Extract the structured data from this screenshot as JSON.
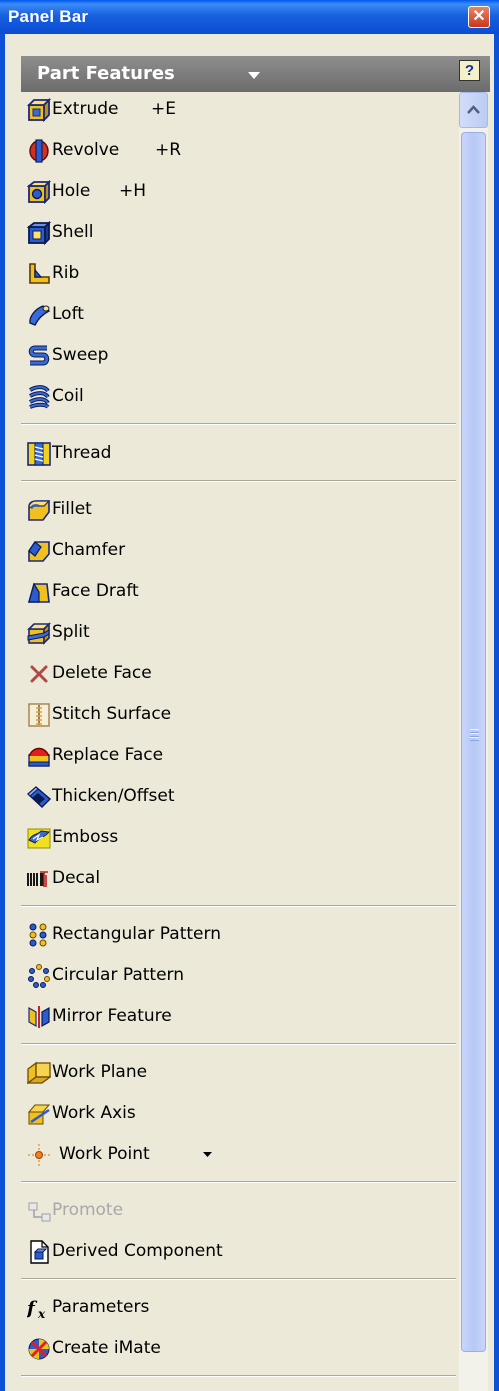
{
  "window": {
    "title": "Panel Bar",
    "close_glyph": "✕"
  },
  "panel": {
    "title": "Part Features",
    "help_glyph": "?"
  },
  "items": [
    {
      "label": "Extrude",
      "shortcut": "+E",
      "icon": "extrude-icon"
    },
    {
      "label": "Revolve",
      "shortcut": "+R",
      "icon": "revolve-icon"
    },
    {
      "label": "Hole",
      "shortcut": "+H",
      "icon": "hole-icon"
    },
    {
      "label": "Shell",
      "icon": "shell-icon"
    },
    {
      "label": "Rib",
      "icon": "rib-icon"
    },
    {
      "label": "Loft",
      "icon": "loft-icon"
    },
    {
      "label": "Sweep",
      "icon": "sweep-icon"
    },
    {
      "label": "Coil",
      "icon": "coil-icon"
    },
    {
      "label": "Thread",
      "icon": "thread-icon"
    },
    {
      "label": "Fillet",
      "icon": "fillet-icon"
    },
    {
      "label": "Chamfer",
      "icon": "chamfer-icon"
    },
    {
      "label": "Face Draft",
      "icon": "face-draft-icon"
    },
    {
      "label": "Split",
      "icon": "split-icon"
    },
    {
      "label": "Delete Face",
      "icon": "delete-face-icon"
    },
    {
      "label": "Stitch Surface",
      "icon": "stitch-surface-icon"
    },
    {
      "label": "Replace Face",
      "icon": "replace-face-icon"
    },
    {
      "label": "Thicken/Offset",
      "icon": "thicken-offset-icon"
    },
    {
      "label": "Emboss",
      "icon": "emboss-icon"
    },
    {
      "label": "Decal",
      "icon": "decal-icon"
    },
    {
      "label": "Rectangular Pattern",
      "icon": "rectangular-pattern-icon"
    },
    {
      "label": "Circular Pattern",
      "icon": "circular-pattern-icon"
    },
    {
      "label": "Mirror Feature",
      "icon": "mirror-feature-icon"
    },
    {
      "label": "Work Plane",
      "icon": "work-plane-icon"
    },
    {
      "label": "Work Axis",
      "icon": "work-axis-icon"
    },
    {
      "label": "Work Point",
      "icon": "work-point-icon",
      "dropdown": true
    },
    {
      "label": "Promote",
      "icon": "promote-icon",
      "disabled": true
    },
    {
      "label": "Derived Component",
      "icon": "derived-component-icon"
    },
    {
      "label": "Parameters",
      "icon": "parameters-icon"
    },
    {
      "label": "Create iMate",
      "icon": "create-imate-icon"
    }
  ],
  "colors": {
    "titlebar": "#0b4bd3",
    "panel_background": "#ece9d8",
    "header_background": "#7a7a7a",
    "scrollbar_thumb": "#b6c8f6",
    "disabled_text": "#a8a8a8"
  }
}
